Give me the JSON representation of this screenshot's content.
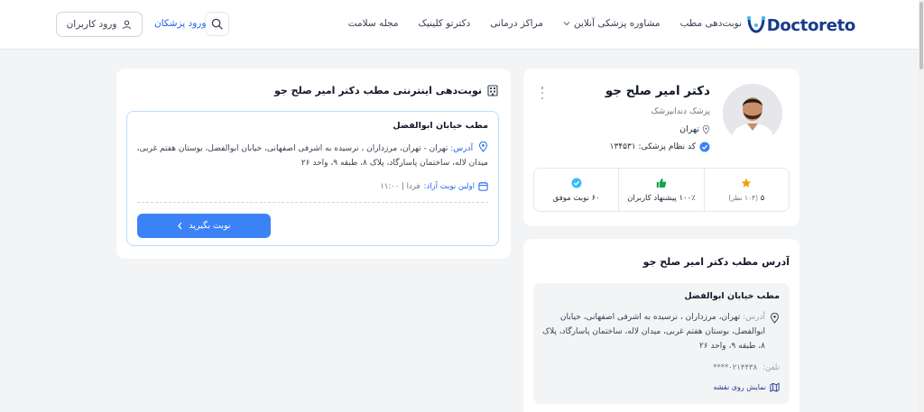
{
  "brand": {
    "name": "Doctoreto",
    "accent": "#2563eb",
    "logo_color": "#173a8c"
  },
  "nav": {
    "items": [
      {
        "label": "نوبت‌دهی مطب"
      },
      {
        "label": "مشاوره پزشکی آنلاین"
      },
      {
        "label": "مراکز درمانی"
      },
      {
        "label": "دکترتو کلینیک"
      },
      {
        "label": "مجله سلامت"
      }
    ],
    "doctors_login": "ورود پزشکان",
    "user_login": "ورود کاربران"
  },
  "profile": {
    "name": "دکتر امیر صلح جو",
    "specialty": "پزشک دندانپزشک",
    "city": "تهران",
    "medical_code": "کد نظام پزشکی: ۱۳۴۵۳۱",
    "stats": [
      {
        "icon": "star-icon",
        "color": "#f59e0b",
        "value": "۵",
        "sub": "(۱۰۴ نظر)"
      },
      {
        "icon": "thumbs-up-icon",
        "color": "#16a34a",
        "value": "۱۰۰٪ پیشنهاد کاربران",
        "sub": ""
      },
      {
        "icon": "check-badge-icon",
        "color": "#38bdf8",
        "value": "۶۰ نوبت موفق",
        "sub": ""
      }
    ]
  },
  "appointment": {
    "title": "نوبت‌دهی اینترنتی مطب دکتر امیر صلح جو",
    "clinic_name": "مطب خیابان ابوالفضل",
    "address_label": "آدرس:",
    "address": "تهران - تهران، مرزداران ، نرسیده به اشرفی اصفهانی، خیابان ابوالفضل، بوستان هفتم غربی، میدان لاله، ساختمان پاسارگاد، پلاک ۸، طبقه ۹، واحد ۲۶",
    "first_label": "اولین نوبت آزاد:",
    "first_value": "فردا | ۱۱:۰۰",
    "book_button": "نوبت بگیرید"
  },
  "address_card": {
    "title": "آدرس مطب دکتر امیر صلح جو",
    "clinic_name": "مطب خیابان ابوالفضل",
    "address_label": "آدرس:",
    "address": "تهران، مرزداران ، نرسیده به اشرفی اصفهانی، خیابان ابوالفضل، بوستان هفتم غربی، میدان لاله، ساختمان پاسارگاد، پلاک ۸، طبقه ۹، واحد ۲۶",
    "phone_label": "تلفن:",
    "phone_value": "۰۲۱۴۴۳۸****",
    "map_link": "نمایش روی نقشه"
  }
}
